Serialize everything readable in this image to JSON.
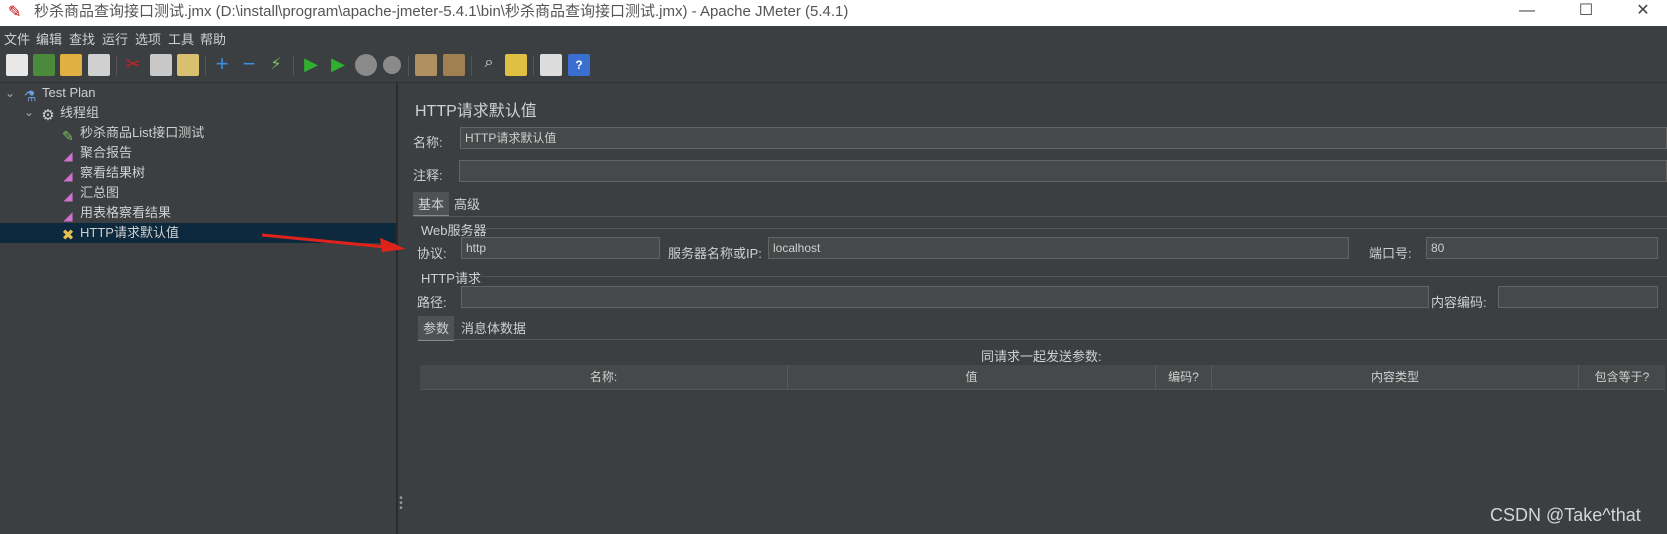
{
  "window": {
    "title": "秒杀商品查询接口测试.jmx (D:\\install\\program\\apache-jmeter-5.4.1\\bin\\秒杀商品查询接口测试.jmx) - Apache JMeter (5.4.1)",
    "minimize": "—",
    "maximize": "☐",
    "close": "✕"
  },
  "menu": [
    "文件",
    "编辑",
    "查找",
    "运行",
    "选项",
    "工具",
    "帮助"
  ],
  "toolbar_icons": [
    "new-icon",
    "templates-icon",
    "open-icon",
    "save-icon",
    "cut-icon",
    "copy-icon",
    "paste-icon",
    "expand-icon",
    "collapse-icon",
    "toggle-icon",
    "start-icon",
    "start-no-pause-icon",
    "stop-icon",
    "shutdown-icon",
    "clear-icon",
    "clear-all-icon",
    "search-icon",
    "reset-search-icon",
    "function-helper-icon",
    "help-icon"
  ],
  "tree": {
    "root": "Test Plan",
    "thread_group": "线程组",
    "children": [
      "秒杀商品List接口测试",
      "聚合报告",
      "察看结果树",
      "汇总图",
      "用表格察看结果",
      "HTTP请求默认值"
    ]
  },
  "panel": {
    "title": "HTTP请求默认值",
    "name_label": "名称:",
    "name_value": "HTTP请求默认值",
    "comment_label": "注释:",
    "comment_value": "",
    "tabs": [
      "基本",
      "高级"
    ],
    "web_server_group": "Web服务器",
    "protocol_label": "协议:",
    "protocol_value": "http",
    "server_label": "服务器名称或IP:",
    "server_value": "localhost",
    "port_label": "端口号:",
    "port_value": "80",
    "http_request_group": "HTTP请求",
    "path_label": "路径:",
    "path_value": "",
    "encoding_label": "内容编码:",
    "encoding_value": "",
    "sub_tabs": [
      "参数",
      "消息体数据"
    ],
    "params_caption": "同请求一起发送参数:",
    "columns": [
      "名称:",
      "值",
      "编码?",
      "内容类型",
      "包含等于?"
    ]
  },
  "watermark": "CSDN @Take^that"
}
